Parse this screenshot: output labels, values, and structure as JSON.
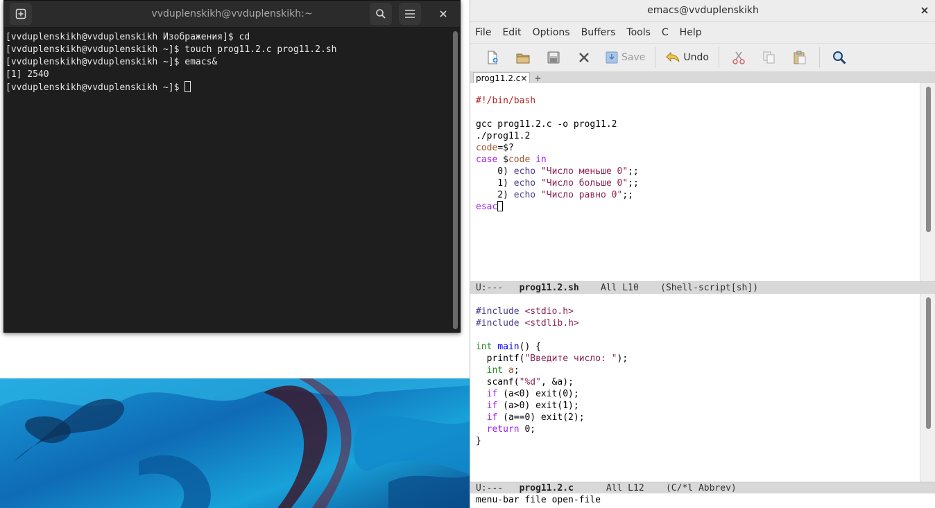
{
  "terminal": {
    "title": "vvduplenskikh@vvduplenskikh:~",
    "lines": [
      "[vvduplenskikh@vvduplenskikh Изображения]$ cd",
      "[vvduplenskikh@vvduplenskikh ~]$ touch prog11.2.c prog11.2.sh",
      "[vvduplenskikh@vvduplenskikh ~]$ emacs&",
      "[1] 2540",
      "[vvduplenskikh@vvduplenskikh ~]$ "
    ],
    "icons": {
      "new_tab": "new-tab-icon",
      "search": "search-icon",
      "menu": "hamburger-menu-icon",
      "close": "close-icon"
    }
  },
  "emacs": {
    "title": "emacs@vvduplenskikh",
    "menu": [
      "File",
      "Edit",
      "Options",
      "Buffers",
      "Tools",
      "C",
      "Help"
    ],
    "toolbar": {
      "save_label": "Save",
      "undo_label": "Undo"
    },
    "tab": {
      "label": "prog11.2.c",
      "close": "×",
      "add": "+"
    },
    "top_pane": {
      "lines": [
        "#!/bin/bash",
        "",
        "gcc prog11.2.c -o prog11.2",
        "./prog11.2",
        "code=$?",
        "case $code in",
        "    0) echo \"Число меньше 0\";;",
        "    1) echo \"Число больше 0\";;",
        "    2) echo \"Число равно 0\";;",
        "esac"
      ],
      "modeline": {
        "status": "U:---",
        "buffer": "prog11.2.sh",
        "position": "All L10",
        "mode": "(Shell-script[sh])"
      }
    },
    "bottom_pane": {
      "lines": [
        "#include <stdio.h>",
        "#include <stdlib.h>",
        "",
        "int main() {",
        "  printf(\"Введите число: \");",
        "  int a;",
        "  scanf(\"%d\", &a);",
        "  if (a<0) exit(0);",
        "  if (a>0) exit(1);",
        "  if (a==0) exit(2);",
        "  return 0;",
        "}"
      ],
      "modeline": {
        "status": "U:---",
        "buffer": "prog11.2.c",
        "position": "All L12",
        "mode": "(C/*l Abbrev)"
      }
    },
    "echo_area": "menu-bar file open-file"
  }
}
